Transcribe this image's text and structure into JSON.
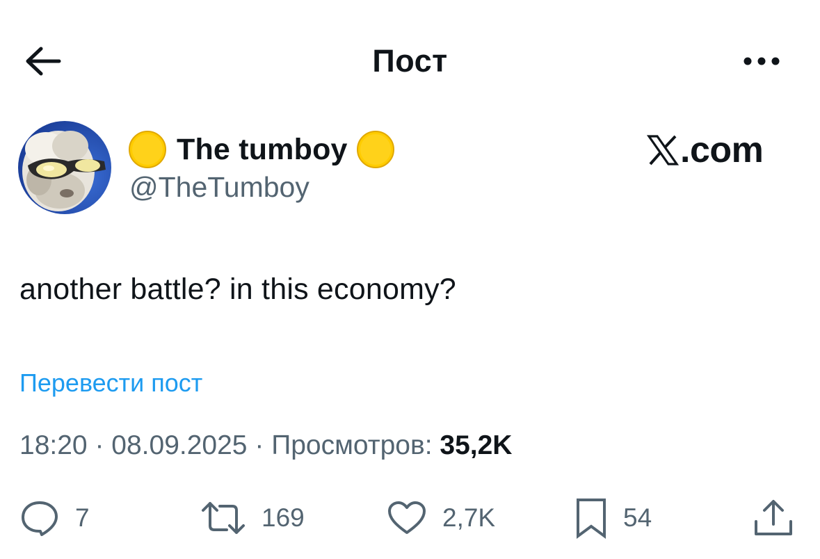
{
  "header": {
    "title": "Пост"
  },
  "author": {
    "display_name": "The tumboy",
    "handle": "@TheTumboy",
    "name_emoji": "yellow-circle"
  },
  "watermark": {
    "text": ".com"
  },
  "post": {
    "text": "another battle? in this economy?",
    "translate_label": "Перевести пост",
    "time": "18:20",
    "date": "08.09.2025",
    "views_label": "Просмотров:",
    "views_count": "35,2K",
    "separator": "·"
  },
  "actions": {
    "replies": "7",
    "reposts": "169",
    "likes": "2,7K",
    "bookmarks": "54"
  },
  "colors": {
    "text": "#0f1419",
    "secondary": "#536471",
    "link": "#1d9bf0",
    "emoji": "#ffcc00"
  }
}
